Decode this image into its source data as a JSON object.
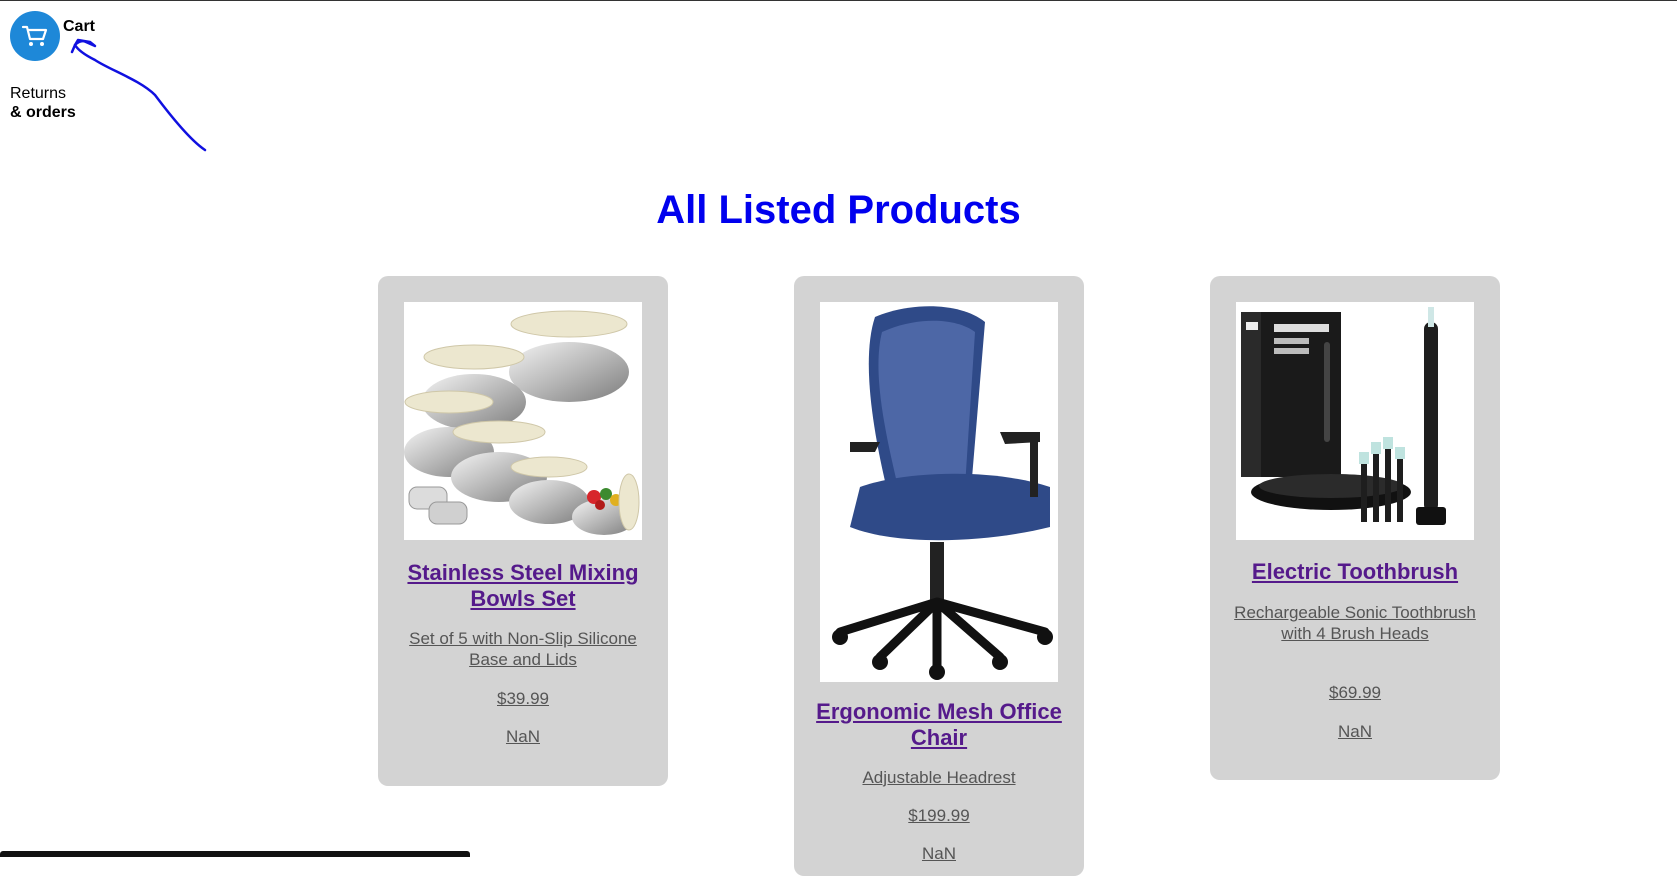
{
  "header": {
    "cart_label": "Cart",
    "returns_line1": "Returns",
    "returns_line2": "& orders"
  },
  "main": {
    "title": "All Listed Products",
    "products": [
      {
        "title": "Stainless Steel Mixing Bowls Set",
        "description": "Set of 5 with Non-Slip Silicone Base and Lids",
        "price": "$39.99",
        "rating": "NaN",
        "image_icon": "mixing-bowls-image"
      },
      {
        "title": "Ergonomic Mesh Office Chair",
        "description": "Adjustable Headrest",
        "price": "$199.99",
        "rating": "NaN",
        "image_icon": "office-chair-image"
      },
      {
        "title": "Electric Toothbrush",
        "description": "Rechargeable Sonic Toothbrush with 4 Brush Heads",
        "price": "$69.99",
        "rating": "NaN",
        "image_icon": "toothbrush-image"
      }
    ]
  },
  "colors": {
    "title": "#0000ee",
    "link_visited": "#551a8b",
    "card_bg": "#d3d3d3",
    "cart_button": "#1e88d8",
    "annotation": "#1010e0"
  }
}
